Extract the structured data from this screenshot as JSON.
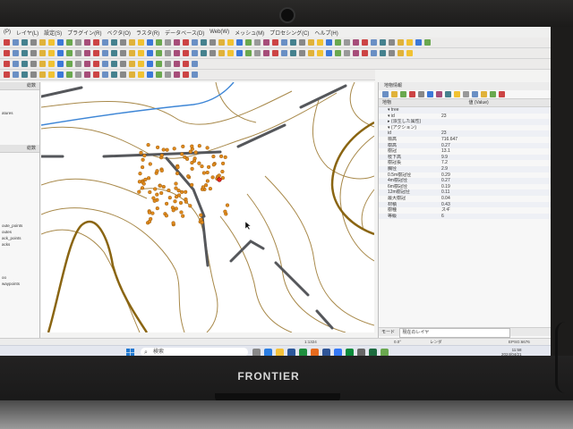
{
  "menu": [
    "(P)",
    "レイヤ(L)",
    "設定(S)",
    "プラグイン(R)",
    "ベクタ(O)",
    "ラスタ(R)",
    "データベース(D)",
    "Web(W)",
    "メッシュ(M)",
    "プロセシング(C)",
    "ヘルプ(H)"
  ],
  "left_panel": {
    "top_header": "総数",
    "items": [
      "atures",
      "oute_points",
      "outes",
      "ack_points",
      "acks",
      "oo",
      "waypoints"
    ],
    "bottom_header": "総数"
  },
  "identify_panel": {
    "title": "地物情報",
    "headers": {
      "feature": "地物",
      "value": "値 (Value)"
    },
    "rows": [
      {
        "k": "▾ tree",
        "v": ""
      },
      {
        "k": "▾ id",
        "v": "23"
      },
      {
        "k": "▸ (派生した属性)",
        "v": ""
      },
      {
        "k": "▾ (アクション)",
        "v": ""
      },
      {
        "k": "id",
        "v": "23"
      },
      {
        "k": "標高",
        "v": "716.647"
      },
      {
        "k": "樹高",
        "v": "0.27"
      },
      {
        "k": "樹冠",
        "v": "13.1"
      },
      {
        "k": "枝下高",
        "v": "9.9"
      },
      {
        "k": "樹冠長",
        "v": "7.2"
      },
      {
        "k": "胸径",
        "v": "2.9"
      },
      {
        "k": "0.5m樹冠径",
        "v": "0.29"
      },
      {
        "k": "4m樹冠径",
        "v": "0.27"
      },
      {
        "k": "6m樹冠径",
        "v": "0.19"
      },
      {
        "k": "12m樹冠径",
        "v": "0.11"
      },
      {
        "k": "最大樹冠",
        "v": "0.04"
      },
      {
        "k": "材積",
        "v": "0.43"
      },
      {
        "k": "樹種",
        "v": "スギ"
      },
      {
        "k": "等級",
        "v": "6"
      }
    ],
    "mode_label": "モード",
    "mode_value": "現在のレイヤ"
  },
  "status": {
    "scale": "1:1324",
    "rotation": "0.0°",
    "render_label": "レンダ",
    "crs": "EPSG:6676"
  },
  "taskbar": {
    "search_placeholder": "検索",
    "clock_time": "11:58",
    "clock_date": "2024/04/21"
  },
  "device": {
    "brand": "FRONTIER"
  },
  "colors": {
    "contour_brown": "#a8894a",
    "contour_thick": "#8a6512",
    "road": "#55575b",
    "stream": "#3e86d6",
    "tree_point": "#e08a1e",
    "selected_point": "#e0281e"
  },
  "map": {
    "tree_points_count_visible": "many",
    "selected_tree_id": "23"
  }
}
